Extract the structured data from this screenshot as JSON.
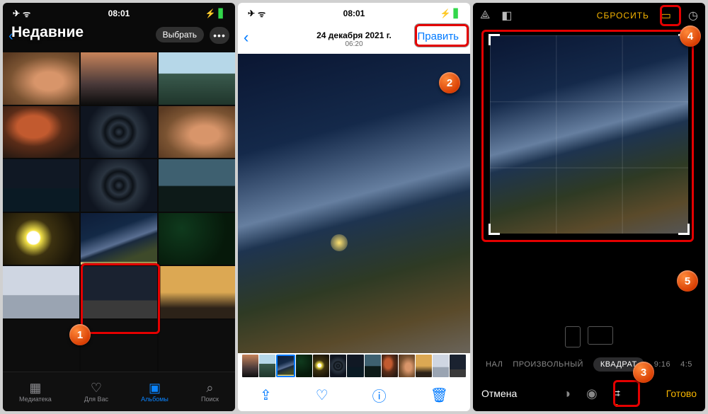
{
  "statusbar": {
    "time": "08:01",
    "airplane": "✈︎",
    "wifi": "⚫",
    "flash": "⚡",
    "battery": "▮▮"
  },
  "s1": {
    "title": "Недавние",
    "select": "Выбрать",
    "tabs": {
      "library": "Медиатека",
      "foryou": "Для Вас",
      "albums": "Альбомы",
      "search": "Поиск"
    }
  },
  "s2": {
    "date": "24 декабря 2021 г.",
    "time": "06:20",
    "edit": "Править"
  },
  "s3": {
    "reset": "СБРОСИТЬ",
    "ratios": {
      "orig": "НАЛ",
      "free": "ПРОИЗВОЛЬНЫЙ",
      "square": "КВАДРАТ",
      "r916": "9:16",
      "r45": "4:5"
    },
    "cancel": "Отмена",
    "done": "Готово"
  },
  "callouts": {
    "c1": "1",
    "c2": "2",
    "c3": "3",
    "c4": "4",
    "c5": "5"
  }
}
